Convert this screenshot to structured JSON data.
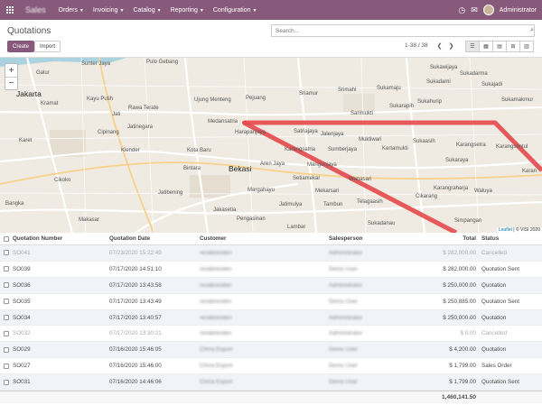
{
  "navbar": {
    "app_name": "Sales",
    "menu": [
      {
        "label": "Orders"
      },
      {
        "label": "Invoicing"
      },
      {
        "label": "Catalog"
      },
      {
        "label": "Reporting"
      },
      {
        "label": "Configuration"
      }
    ],
    "user": "Administrator",
    "activity_count": "",
    "message_count": ""
  },
  "control_panel": {
    "title": "Quotations",
    "search_placeholder": "Search...",
    "create_label": "Create",
    "import_label": "Import",
    "pager": "1-38 / 38",
    "views": [
      "list-view-icon",
      "kanban-view-icon",
      "calendar-view-icon",
      "pivot-view-icon",
      "graph-view-icon"
    ],
    "active_view": "list-view-icon"
  },
  "map": {
    "places": [
      {
        "name": "Jakarta",
        "kind": "city"
      },
      {
        "name": "Bekasi",
        "kind": "city"
      },
      {
        "name": "Sunter Jaya"
      },
      {
        "name": "Pulo Gebang"
      },
      {
        "name": "Ujung Menteng"
      },
      {
        "name": "Pejuang"
      },
      {
        "name": "Medansatria"
      },
      {
        "name": "Harapanjaya"
      },
      {
        "name": "Kota Baru"
      },
      {
        "name": "Bintara"
      },
      {
        "name": "Aren Jaya"
      },
      {
        "name": "Margahayu"
      },
      {
        "name": "Jatibening"
      },
      {
        "name": "Jakasetia"
      },
      {
        "name": "Pengasinan"
      },
      {
        "name": "Lambar"
      },
      {
        "name": "Kayu Putih"
      },
      {
        "name": "Rawa Terate"
      },
      {
        "name": "Kramat"
      },
      {
        "name": "Cipinang"
      },
      {
        "name": "Jatinegara"
      },
      {
        "name": "Klender"
      },
      {
        "name": "Karet"
      },
      {
        "name": "Cikoko"
      },
      {
        "name": "Bangka"
      },
      {
        "name": "Makasar"
      },
      {
        "name": "Galur"
      },
      {
        "name": "Jati"
      },
      {
        "name": "Sriamur"
      },
      {
        "name": "Srimahi"
      },
      {
        "name": "Sukamaju"
      },
      {
        "name": "Sukawijaya"
      },
      {
        "name": "Sukadarma"
      },
      {
        "name": "Sukadami"
      },
      {
        "name": "Sukahurip"
      },
      {
        "name": "Sukajadi"
      },
      {
        "name": "Sukamakmur"
      },
      {
        "name": "Sarimukti"
      },
      {
        "name": "Sukarapih"
      },
      {
        "name": "Satriajaya"
      },
      {
        "name": "Jalenjaya"
      },
      {
        "name": "Sumberjaya"
      },
      {
        "name": "Muktiwari"
      },
      {
        "name": "Kertamukti"
      },
      {
        "name": "Sukaasih"
      },
      {
        "name": "Karangsetra"
      },
      {
        "name": "Karangsentul"
      },
      {
        "name": "Sukaraya"
      },
      {
        "name": "Karangraharja"
      },
      {
        "name": "Waluya"
      },
      {
        "name": "Wanasari"
      },
      {
        "name": "Setiamekar"
      },
      {
        "name": "Mekarsari"
      },
      {
        "name": "Telagaasih"
      },
      {
        "name": "Cikarang"
      },
      {
        "name": "Sukadanau"
      },
      {
        "name": "Simpangan"
      },
      {
        "name": "Tambun"
      },
      {
        "name": "Jatimulya"
      },
      {
        "name": "Karangsatria"
      },
      {
        "name": "Mangunjaya"
      },
      {
        "name": "Karan"
      }
    ],
    "attribution_leaflet": "Leaflet",
    "attribution_rest": "| © VISI 2020",
    "route_color": "#e5484d"
  },
  "table": {
    "columns": [
      "Quotation Number",
      "Quotation Date",
      "Customer",
      "Salesperson",
      "Total",
      "Status"
    ],
    "rows": [
      {
        "number": "SO041",
        "date": "07/23/2020 15:22:49",
        "customer": "rezabrenden",
        "salesperson": "Administrator",
        "total": "$ 282,000.00",
        "status": "Cancelled",
        "cancelled": true
      },
      {
        "number": "SO039",
        "date": "07/17/2020 14:51:10",
        "customer": "rezabrenden",
        "salesperson": "Demo User",
        "total": "$ 282,000.00",
        "status": "Quotation Sent",
        "cancelled": false
      },
      {
        "number": "SO036",
        "date": "07/17/2020 13:43:58",
        "customer": "rezabrenden",
        "salesperson": "Administrator",
        "total": "$ 250,000.00",
        "status": "Quotation",
        "cancelled": false
      },
      {
        "number": "SO035",
        "date": "07/17/2020 13:43:49",
        "customer": "rezabrenden",
        "salesperson": "Demo User",
        "total": "$ 250,885.00",
        "status": "Quotation Sent",
        "cancelled": false
      },
      {
        "number": "SO034",
        "date": "07/17/2020 13:40:57",
        "customer": "rezabrenden",
        "salesperson": "Administrator",
        "total": "$ 250,000.00",
        "status": "Quotation",
        "cancelled": false
      },
      {
        "number": "SO032",
        "date": "07/17/2020 13:30:21",
        "customer": "rezabrenden",
        "salesperson": "Administrator",
        "total": "$ 0.00",
        "status": "Cancelled",
        "cancelled": true
      },
      {
        "number": "SO029",
        "date": "07/16/2020 15:46:05",
        "customer": "China Export",
        "salesperson": "Demo User",
        "total": "$ 4,200.00",
        "status": "Quotation",
        "cancelled": false
      },
      {
        "number": "SO027",
        "date": "07/16/2020 15:46:00",
        "customer": "China Export",
        "salesperson": "Demo User",
        "total": "$ 1,799.00",
        "status": "Sales Order",
        "cancelled": false
      },
      {
        "number": "SO031",
        "date": "07/16/2020 14:46:06",
        "customer": "China Export",
        "salesperson": "Demo User",
        "total": "$ 1,799.00",
        "status": "Quotation Sent",
        "cancelled": false
      }
    ],
    "grand_total": "1,460,141.50"
  },
  "colors": {
    "brand": "#875A7B"
  }
}
